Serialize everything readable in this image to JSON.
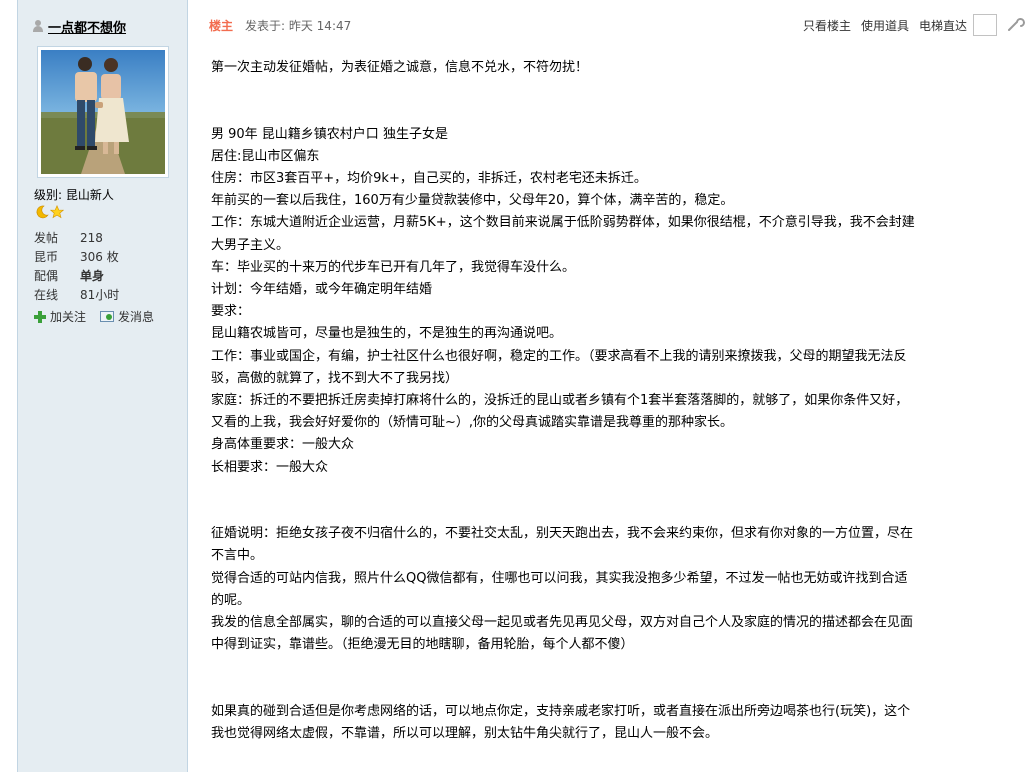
{
  "author": {
    "name": "一点都不想你",
    "level_label": "级别:",
    "level_value": "昆山新人"
  },
  "stats": [
    {
      "label": "发帖",
      "value": "218"
    },
    {
      "label": "昆币",
      "value": "306 枚"
    },
    {
      "label": "配偶",
      "value": "单身"
    },
    {
      "label": "在线",
      "value": "81小时"
    }
  ],
  "actions": {
    "follow": "加关注",
    "message": "发消息"
  },
  "post": {
    "floor": "楼主",
    "time": "发表于: 昨天 14:47",
    "only_author": "只看楼主",
    "use_tool": "使用道具",
    "jump": "电梯直达"
  },
  "content": [
    "第一次主动发征婚帖，为表征婚之诚意，信息不兑水，不符勿扰！",
    "",
    "",
    "男 90年 昆山籍乡镇农村户口 独生子女是",
    "居住:昆山市区偏东",
    "住房：市区3套百平+，均价9k+，自己买的，非拆迁，农村老宅还未拆迁。",
    "年前买的一套以后我住，160万有少量贷款装修中，父母年20，算个体，满辛苦的，稳定。",
    "工作：东城大道附近企业运营，月薪5K+，这个数目前来说属于低阶弱势群体，如果你很结棍，不介意引导我，我不会封建",
    "大男子主义。",
    "车：毕业买的十来万的代步车已开有几年了，我觉得车没什么。",
    "计划：今年结婚，或今年确定明年结婚",
    "要求：",
    "昆山籍农城皆可，尽量也是独生的，不是独生的再沟通说吧。",
    "工作：事业或国企，有编，护士社区什么也很好啊，稳定的工作。（要求高看不上我的请别来撩拨我，父母的期望我无法反",
    "驳，高傲的就算了，找不到大不了我另找）",
    "家庭：拆迁的不要把拆迁房卖掉打麻将什么的，没拆迁的昆山或者乡镇有个1套半套落落脚的，就够了，如果你条件又好，",
    "又看的上我，我会好好爱你的（矫情可耻~）,你的父母真诚踏实靠谱是我尊重的那种家长。",
    "身高体重要求：一般大众",
    "长相要求：一般大众",
    "",
    "",
    "征婚说明：拒绝女孩子夜不归宿什么的，不要社交太乱，别天天跑出去，我不会来约束你，但求有你对象的一方位置，尽在",
    "不言中。",
    "觉得合适的可站内信我，照片什么QQ微信都有，住哪也可以问我，其实我没抱多少希望，不过发一帖也无妨或许找到合适",
    "的呢。",
    "我发的信息全部属实，聊的合适的可以直接父母一起见或者先见再见父母，双方对自己个人及家庭的情况的描述都会在见面",
    "中得到证实，靠谱些。（拒绝漫无目的地瞎聊，备用轮胎，每个人都不傻）",
    "",
    "",
    "如果真的碰到合适但是你考虑网络的话，可以地点你定，支持亲戚老家打听，或者直接在派出所旁边喝茶也行(玩笑)，这个",
    "我也觉得网络太虚假，不靠谱，所以可以理解，别太钻牛角尖就行了，昆山人一般不会。"
  ],
  "colors": {
    "sidebar_bg": "#e5edf2",
    "floor_tag": "#f26c4f",
    "border": "#c2d5e3"
  }
}
